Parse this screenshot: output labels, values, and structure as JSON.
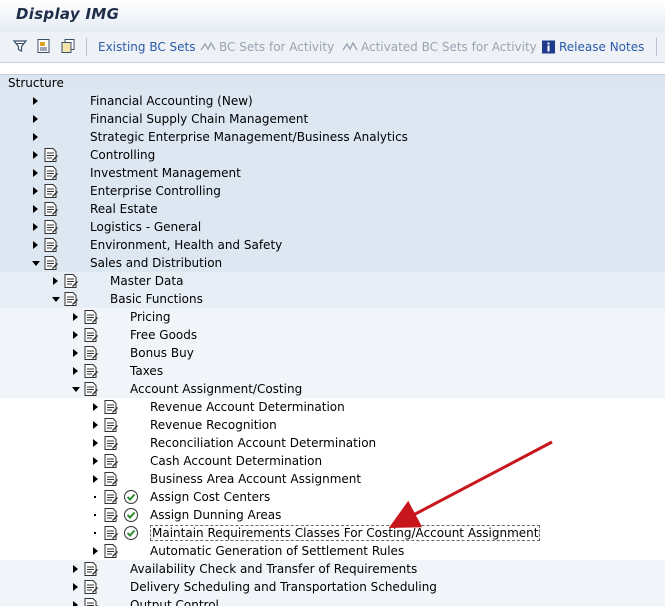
{
  "window": {
    "title": "Display IMG"
  },
  "toolbar": {
    "icons": [
      "filter-icon",
      "documentation-icon",
      "copy-icon"
    ],
    "buttons": [
      {
        "label": "Existing BC Sets",
        "icon": "bc-sets-icon",
        "enabled": true
      },
      {
        "label": "BC Sets for Activity",
        "icon": "bc-activity-icon",
        "enabled": false
      },
      {
        "label": "Activated BC Sets for Activity",
        "icon": "bc-activated-icon",
        "enabled": false
      },
      {
        "label": "Release Notes",
        "icon": "info-icon",
        "enabled": true
      }
    ]
  },
  "structure": {
    "header": "Structure"
  },
  "tree": [
    {
      "label": "Financial Accounting (New)",
      "level": 0,
      "expander": "closed",
      "doc": false
    },
    {
      "label": "Financial Supply Chain Management",
      "level": 0,
      "expander": "closed",
      "doc": false
    },
    {
      "label": "Strategic Enterprise Management/Business Analytics",
      "level": 0,
      "expander": "closed",
      "doc": false
    },
    {
      "label": "Controlling",
      "level": 0,
      "expander": "closed",
      "doc": true
    },
    {
      "label": "Investment Management",
      "level": 0,
      "expander": "closed",
      "doc": true
    },
    {
      "label": "Enterprise Controlling",
      "level": 0,
      "expander": "closed",
      "doc": true
    },
    {
      "label": "Real Estate",
      "level": 0,
      "expander": "closed",
      "doc": true
    },
    {
      "label": "Logistics - General",
      "level": 0,
      "expander": "closed",
      "doc": true
    },
    {
      "label": "Environment, Health and Safety",
      "level": 0,
      "expander": "closed",
      "doc": true
    },
    {
      "label": "Sales and Distribution",
      "level": 0,
      "expander": "open",
      "doc": true
    },
    {
      "label": "Master Data",
      "level": 1,
      "expander": "closed",
      "doc": true
    },
    {
      "label": "Basic Functions",
      "level": 1,
      "expander": "open",
      "doc": true
    },
    {
      "label": "Pricing",
      "level": 2,
      "expander": "closed",
      "doc": true
    },
    {
      "label": "Free Goods",
      "level": 2,
      "expander": "closed",
      "doc": true
    },
    {
      "label": "Bonus Buy",
      "level": 2,
      "expander": "closed",
      "doc": true
    },
    {
      "label": "Taxes",
      "level": 2,
      "expander": "closed",
      "doc": true
    },
    {
      "label": "Account Assignment/Costing",
      "level": 2,
      "expander": "open",
      "doc": true
    },
    {
      "label": "Revenue Account Determination",
      "level": 3,
      "expander": "closed",
      "doc": true
    },
    {
      "label": "Revenue Recognition",
      "level": 3,
      "expander": "closed",
      "doc": true
    },
    {
      "label": "Reconciliation Account Determination",
      "level": 3,
      "expander": "closed",
      "doc": true
    },
    {
      "label": "Cash Account Determination",
      "level": 3,
      "expander": "closed",
      "doc": true
    },
    {
      "label": "Business Area Account Assignment",
      "level": 3,
      "expander": "closed",
      "doc": true
    },
    {
      "label": "Assign Cost Centers",
      "level": 3,
      "expander": "leaf",
      "doc": true,
      "execute": true
    },
    {
      "label": "Assign Dunning Areas",
      "level": 3,
      "expander": "leaf",
      "doc": true,
      "execute": true
    },
    {
      "label": "Maintain Requirements Classes For Costing/Account Assignment",
      "level": 3,
      "expander": "leaf",
      "doc": true,
      "execute": true,
      "selected": true
    },
    {
      "label": "Automatic Generation of Settlement Rules",
      "level": 3,
      "expander": "closed",
      "doc": true
    },
    {
      "label": "Availability Check and Transfer of Requirements",
      "level": 2,
      "expander": "closed",
      "doc": true
    },
    {
      "label": "Delivery Scheduling and Transportation Scheduling",
      "level": 2,
      "expander": "closed",
      "doc": true
    },
    {
      "label": "Output Control",
      "level": 2,
      "expander": "closed",
      "doc": true
    }
  ],
  "colors": {
    "band_level0": "#dce7f2",
    "band_level1": "#e7eef6",
    "band_level2": "#f1f5fa",
    "band_level3": "#ffffff",
    "arrow": "#c8161d",
    "link": "#2b5aa8"
  }
}
